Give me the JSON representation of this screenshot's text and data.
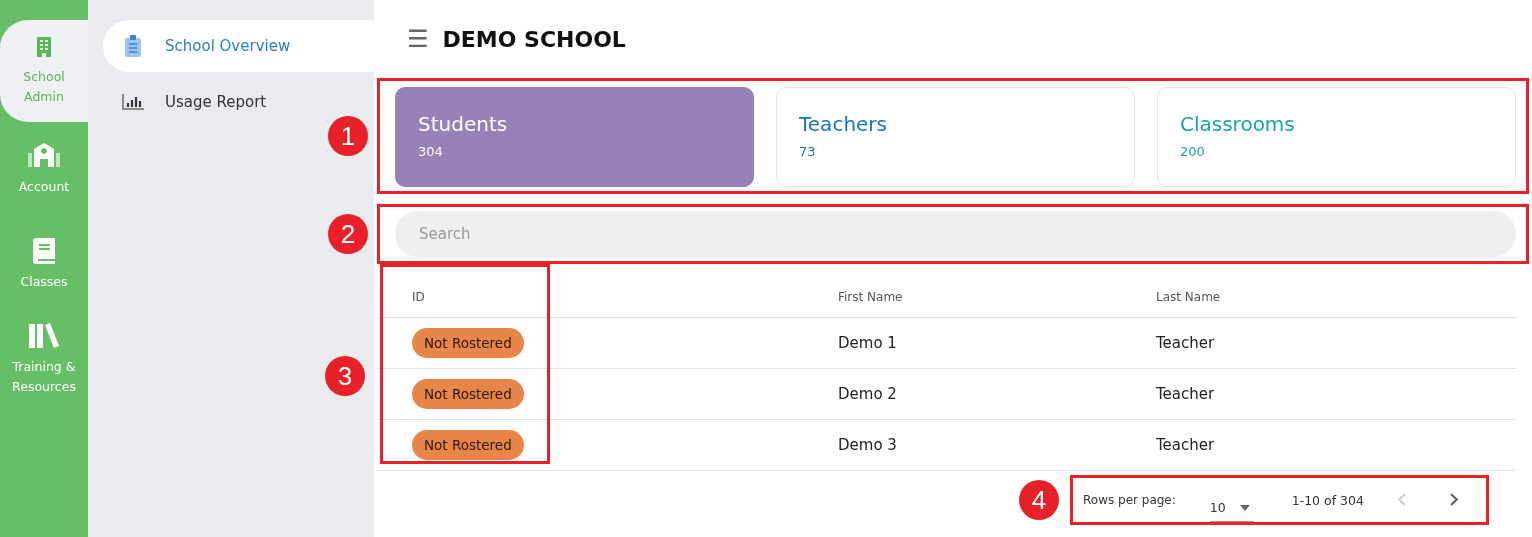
{
  "rail": {
    "items": [
      {
        "label": "School Admin",
        "selected": true
      },
      {
        "label": "Account",
        "selected": false
      },
      {
        "label": "Classes",
        "selected": false
      },
      {
        "label": "Training & Resources",
        "selected": false
      }
    ]
  },
  "sidebar": {
    "items": [
      {
        "label": "School Overview",
        "selected": true
      },
      {
        "label": "Usage Report",
        "selected": false
      }
    ]
  },
  "header": {
    "menu_icon": "☰",
    "title": "DEMO SCHOOL"
  },
  "cards": [
    {
      "label": "Students",
      "count": "304",
      "color": "#9781b6",
      "selected": true
    },
    {
      "label": "Teachers",
      "count": "73",
      "color": "#1a73c0",
      "selected": false
    },
    {
      "label": "Classrooms",
      "count": "200",
      "color": "#17a2b0",
      "selected": false
    }
  ],
  "search": {
    "placeholder": "Search"
  },
  "table": {
    "columns": [
      "ID",
      "First Name",
      "Last Name"
    ],
    "rows": [
      {
        "status": "Not Rostered",
        "first_name": "Demo 1",
        "last_name": "Teacher"
      },
      {
        "status": "Not Rostered",
        "first_name": "Demo 2",
        "last_name": "Teacher"
      },
      {
        "status": "Not Rostered",
        "first_name": "Demo 3",
        "last_name": "Teacher"
      }
    ]
  },
  "pagination": {
    "rows_label": "Rows per page:",
    "rows_value": "10",
    "range": "1-10 of 304",
    "prev_disabled": true,
    "next_disabled": false
  },
  "annotations": [
    "1",
    "2",
    "3",
    "4"
  ]
}
